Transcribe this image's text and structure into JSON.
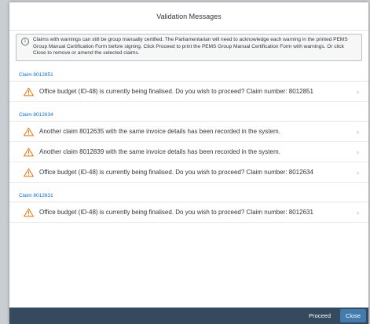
{
  "dialog": {
    "title": "Validation Messages",
    "info_text": "Claims with warnings can still be group manually certified. The Parliamentarian will need to acknowledge each warning in the printed PEMS Group Manual Certification Form before signing. Click Proceed to print the PEMS Group Manual Certification Form with warnings. Or click Close to remove or amend the selected claims."
  },
  "groups": [
    {
      "header": "Claim 8012851",
      "messages": [
        "Office budget (ID-48) is currently being finalised. Do you wish to proceed? Claim number: 8012851"
      ]
    },
    {
      "header": "Claim 8012634",
      "messages": [
        "Another claim 8012635 with the same invoice details has been recorded in the system.",
        "Another claim 8012839 with the same invoice details has been recorded in the system.",
        "Office budget (ID-48) is currently being finalised. Do you wish to proceed? Claim number: 8012634"
      ]
    },
    {
      "header": "Claim 8012631",
      "messages": [
        "Office budget (ID-48) is currently being finalised. Do you wish to proceed? Claim number: 8012631"
      ]
    }
  ],
  "footer": {
    "proceed_label": "Proceed",
    "close_label": "Close"
  },
  "colors": {
    "warning": "#e9730c",
    "link": "#0a6ed1",
    "footer_bg": "#354a5f",
    "close_bg": "#427cac"
  },
  "icons": {
    "info": "info-icon",
    "warning": "warning-triangle-icon",
    "chevron": "chevron-right-icon"
  }
}
